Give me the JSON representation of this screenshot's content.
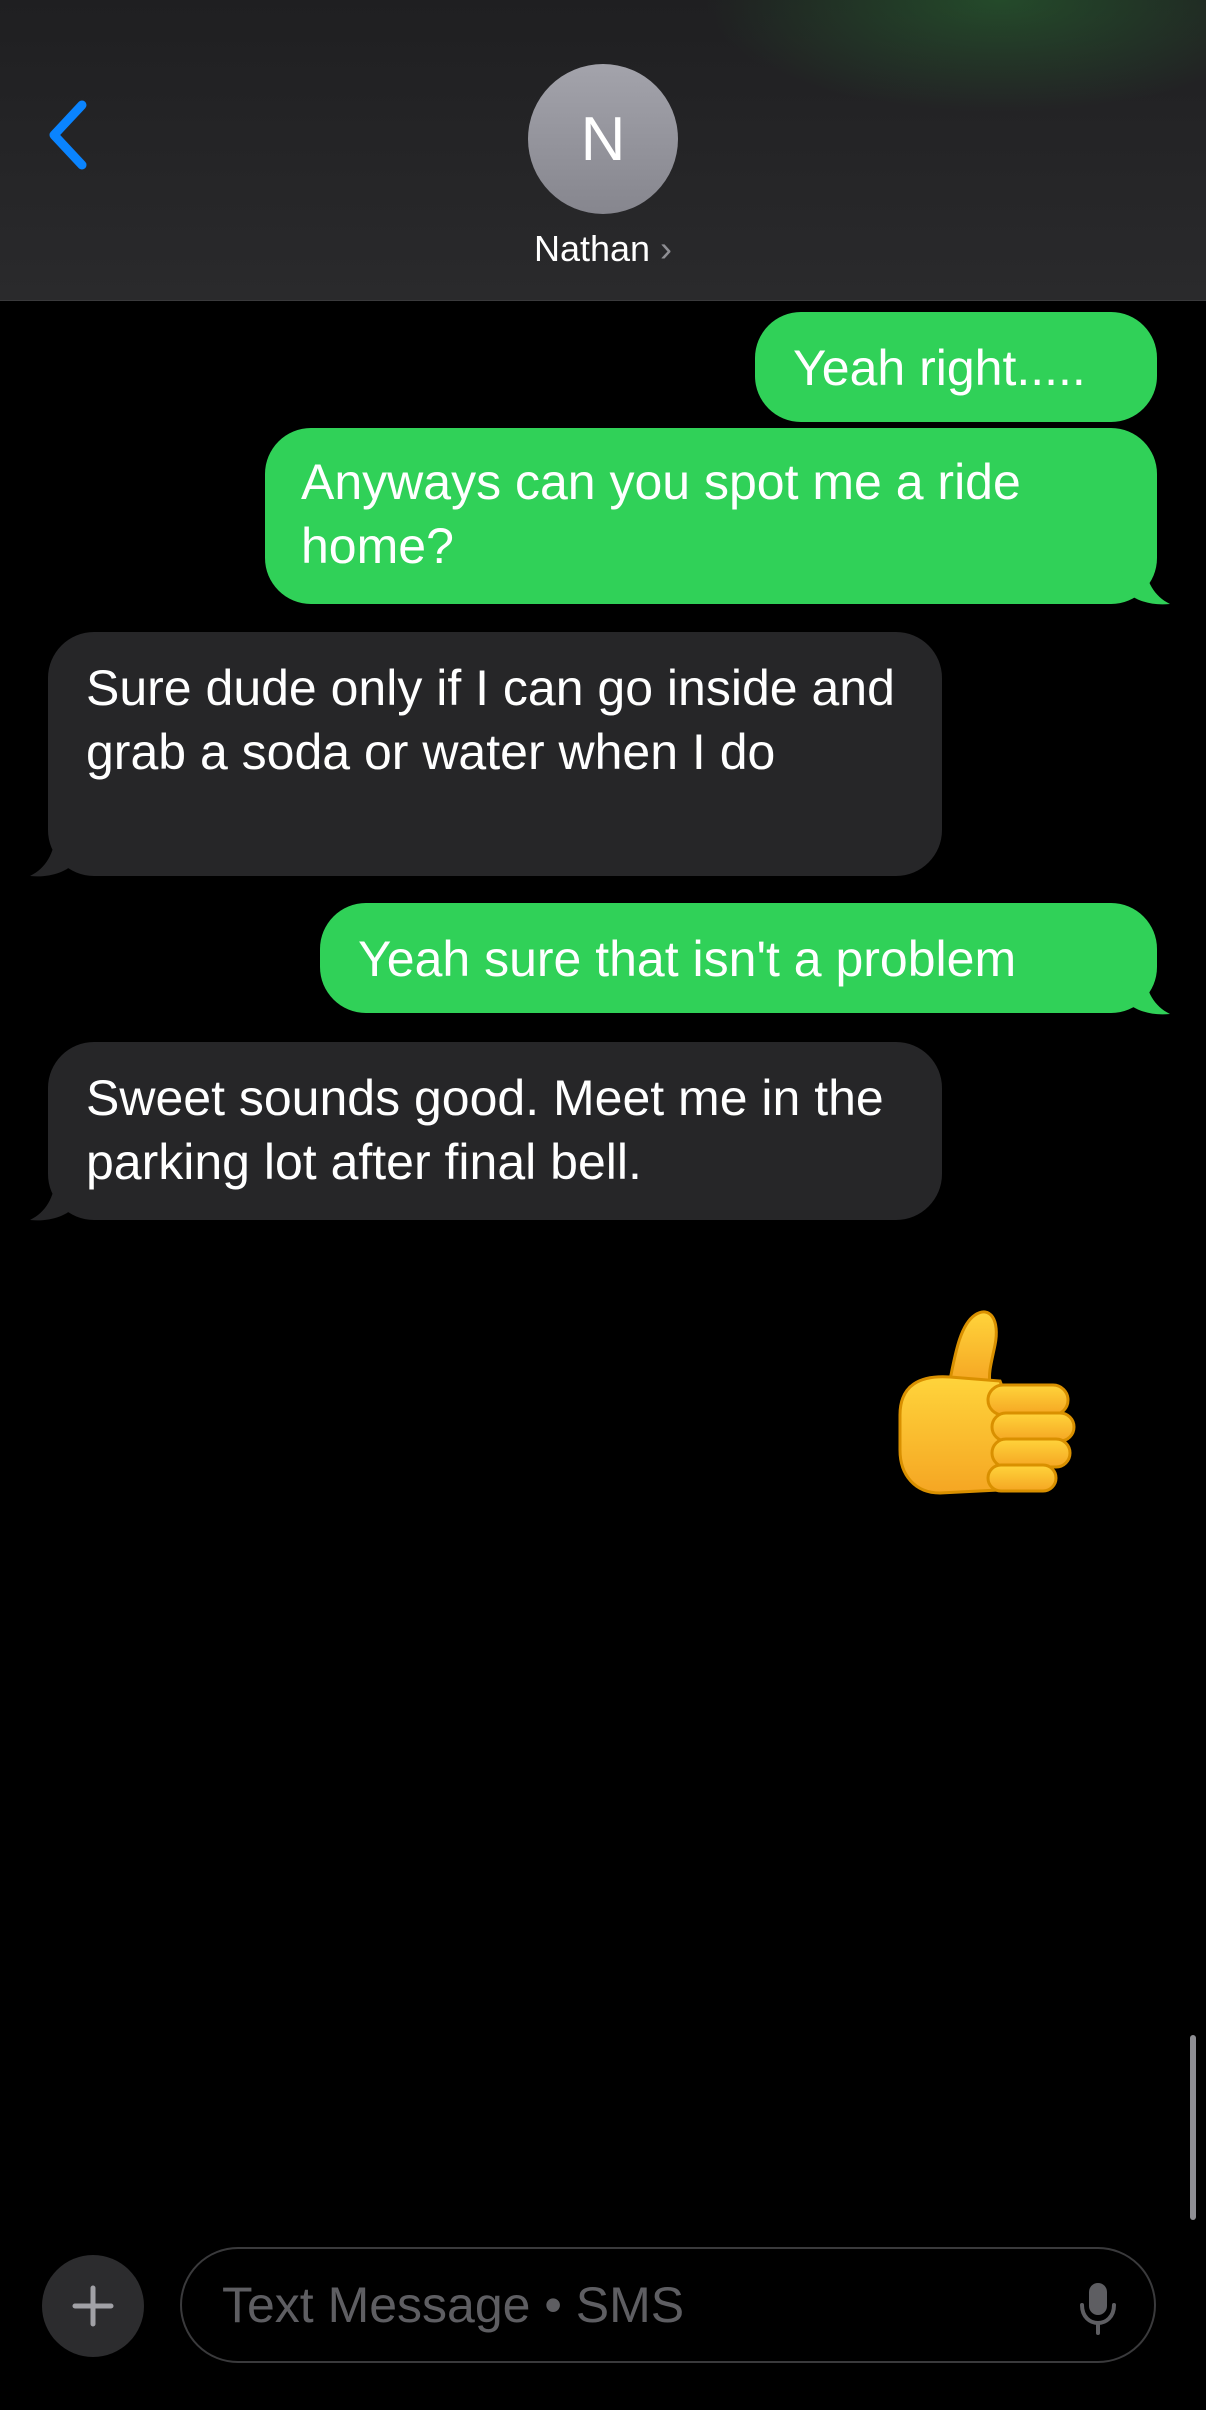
{
  "header": {
    "avatar_initial": "N",
    "contact_name": "Nathan",
    "chevron": "›"
  },
  "messages": [
    {
      "from": "me",
      "text": "Yeah right....."
    },
    {
      "from": "me",
      "text": "Anyways can you spot me a ride home?"
    },
    {
      "from": "them",
      "text": "Sure dude only if I can go inside and grab a soda or water when I do"
    },
    {
      "from": "me",
      "text": "Yeah sure that isn't a problem"
    },
    {
      "from": "them",
      "text": "Sweet sounds good. Meet me in the parking lot after final bell."
    },
    {
      "from": "me",
      "emoji": "thumbs-up-emoji"
    }
  ],
  "composer": {
    "placeholder": "Text Message • SMS",
    "plus_icon": "plus-icon",
    "mic_icon": "microphone-icon"
  },
  "colors": {
    "sent_bubble": "#30d158",
    "received_bubble": "#262628",
    "accent": "#0a84ff",
    "background": "#000000"
  }
}
